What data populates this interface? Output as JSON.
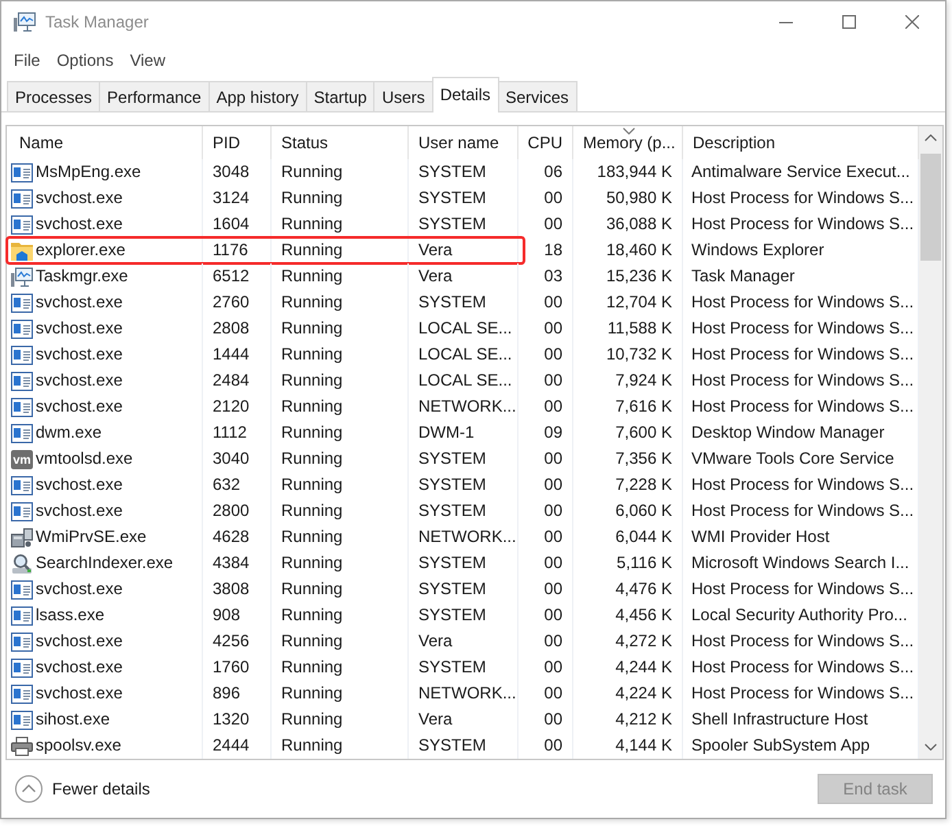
{
  "window": {
    "title": "Task Manager"
  },
  "menu": [
    "File",
    "Options",
    "View"
  ],
  "tabs": [
    {
      "label": "Processes",
      "selected": false
    },
    {
      "label": "Performance",
      "selected": false
    },
    {
      "label": "App history",
      "selected": false
    },
    {
      "label": "Startup",
      "selected": false
    },
    {
      "label": "Users",
      "selected": false
    },
    {
      "label": "Details",
      "selected": true
    },
    {
      "label": "Services",
      "selected": false
    }
  ],
  "table": {
    "columns": [
      {
        "label": "Name",
        "sorted": false
      },
      {
        "label": "PID",
        "sorted": false
      },
      {
        "label": "Status",
        "sorted": false
      },
      {
        "label": "User name",
        "sorted": false
      },
      {
        "label": "CPU",
        "sorted": false
      },
      {
        "label": "Memory (p...",
        "sorted": true
      },
      {
        "label": "Description",
        "sorted": false
      }
    ],
    "rows": [
      {
        "kind": "app",
        "name": "MsMpEng.exe",
        "pid": "3048",
        "status": "Running",
        "user_name": "SYSTEM",
        "cpu": "06",
        "memory": "183,944 K",
        "description": "Antimalware Service Execut...",
        "highlighted": false
      },
      {
        "kind": "app",
        "name": "svchost.exe",
        "pid": "3124",
        "status": "Running",
        "user_name": "SYSTEM",
        "cpu": "00",
        "memory": "50,980 K",
        "description": "Host Process for Windows S...",
        "highlighted": false
      },
      {
        "kind": "app",
        "name": "svchost.exe",
        "pid": "1604",
        "status": "Running",
        "user_name": "SYSTEM",
        "cpu": "00",
        "memory": "36,088 K",
        "description": "Host Process for Windows S...",
        "highlighted": false
      },
      {
        "kind": "folder",
        "name": "explorer.exe",
        "pid": "1176",
        "status": "Running",
        "user_name": "Vera",
        "cpu": "18",
        "memory": "18,460 K",
        "description": "Windows Explorer",
        "highlighted": true
      },
      {
        "kind": "monitor",
        "name": "Taskmgr.exe",
        "pid": "6512",
        "status": "Running",
        "user_name": "Vera",
        "cpu": "03",
        "memory": "15,236 K",
        "description": "Task Manager",
        "highlighted": false
      },
      {
        "kind": "app",
        "name": "svchost.exe",
        "pid": "2760",
        "status": "Running",
        "user_name": "SYSTEM",
        "cpu": "00",
        "memory": "12,704 K",
        "description": "Host Process for Windows S...",
        "highlighted": false
      },
      {
        "kind": "app",
        "name": "svchost.exe",
        "pid": "2808",
        "status": "Running",
        "user_name": "LOCAL SE...",
        "cpu": "00",
        "memory": "11,588 K",
        "description": "Host Process for Windows S...",
        "highlighted": false
      },
      {
        "kind": "app",
        "name": "svchost.exe",
        "pid": "1444",
        "status": "Running",
        "user_name": "LOCAL SE...",
        "cpu": "00",
        "memory": "10,732 K",
        "description": "Host Process for Windows S...",
        "highlighted": false
      },
      {
        "kind": "app",
        "name": "svchost.exe",
        "pid": "2484",
        "status": "Running",
        "user_name": "LOCAL SE...",
        "cpu": "00",
        "memory": "7,924 K",
        "description": "Host Process for Windows S...",
        "highlighted": false
      },
      {
        "kind": "app",
        "name": "svchost.exe",
        "pid": "2120",
        "status": "Running",
        "user_name": "NETWORK...",
        "cpu": "00",
        "memory": "7,616 K",
        "description": "Host Process for Windows S...",
        "highlighted": false
      },
      {
        "kind": "app",
        "name": "dwm.exe",
        "pid": "1112",
        "status": "Running",
        "user_name": "DWM-1",
        "cpu": "09",
        "memory": "7,600 K",
        "description": "Desktop Window Manager",
        "highlighted": false
      },
      {
        "kind": "tile",
        "icon_label": "vm",
        "name": "vmtoolsd.exe",
        "pid": "3040",
        "status": "Running",
        "user_name": "SYSTEM",
        "cpu": "00",
        "memory": "7,356 K",
        "description": "VMware Tools Core Service",
        "highlighted": false
      },
      {
        "kind": "app",
        "name": "svchost.exe",
        "pid": "632",
        "status": "Running",
        "user_name": "SYSTEM",
        "cpu": "00",
        "memory": "7,228 K",
        "description": "Host Process for Windows S...",
        "highlighted": false
      },
      {
        "kind": "app",
        "name": "svchost.exe",
        "pid": "2800",
        "status": "Running",
        "user_name": "SYSTEM",
        "cpu": "00",
        "memory": "6,060 K",
        "description": "Host Process for Windows S...",
        "highlighted": false
      },
      {
        "kind": "computer",
        "name": "WmiPrvSE.exe",
        "pid": "4628",
        "status": "Running",
        "user_name": "NETWORK...",
        "cpu": "00",
        "memory": "6,044 K",
        "description": "WMI Provider Host",
        "highlighted": false
      },
      {
        "kind": "search",
        "name": "SearchIndexer.exe",
        "pid": "4384",
        "status": "Running",
        "user_name": "SYSTEM",
        "cpu": "00",
        "memory": "5,116 K",
        "description": "Microsoft Windows Search I...",
        "highlighted": false
      },
      {
        "kind": "app",
        "name": "svchost.exe",
        "pid": "3808",
        "status": "Running",
        "user_name": "SYSTEM",
        "cpu": "00",
        "memory": "4,476 K",
        "description": "Host Process for Windows S...",
        "highlighted": false
      },
      {
        "kind": "app",
        "name": "lsass.exe",
        "pid": "908",
        "status": "Running",
        "user_name": "SYSTEM",
        "cpu": "00",
        "memory": "4,456 K",
        "description": "Local Security Authority Pro...",
        "highlighted": false
      },
      {
        "kind": "app",
        "name": "svchost.exe",
        "pid": "4256",
        "status": "Running",
        "user_name": "Vera",
        "cpu": "00",
        "memory": "4,272 K",
        "description": "Host Process for Windows S...",
        "highlighted": false
      },
      {
        "kind": "app",
        "name": "svchost.exe",
        "pid": "1760",
        "status": "Running",
        "user_name": "SYSTEM",
        "cpu": "00",
        "memory": "4,244 K",
        "description": "Host Process for Windows S...",
        "highlighted": false
      },
      {
        "kind": "app",
        "name": "svchost.exe",
        "pid": "896",
        "status": "Running",
        "user_name": "NETWORK...",
        "cpu": "00",
        "memory": "4,224 K",
        "description": "Host Process for Windows S...",
        "highlighted": false
      },
      {
        "kind": "app",
        "name": "sihost.exe",
        "pid": "1320",
        "status": "Running",
        "user_name": "Vera",
        "cpu": "00",
        "memory": "4,212 K",
        "description": "Shell Infrastructure Host",
        "highlighted": false
      },
      {
        "kind": "printer",
        "name": "spoolsv.exe",
        "pid": "2444",
        "status": "Running",
        "user_name": "SYSTEM",
        "cpu": "00",
        "memory": "4,144 K",
        "description": "Spooler SubSystem App",
        "highlighted": false
      }
    ]
  },
  "footer": {
    "details_toggle": "Fewer details",
    "end_task": {
      "label": "End task",
      "disabled": true
    }
  }
}
